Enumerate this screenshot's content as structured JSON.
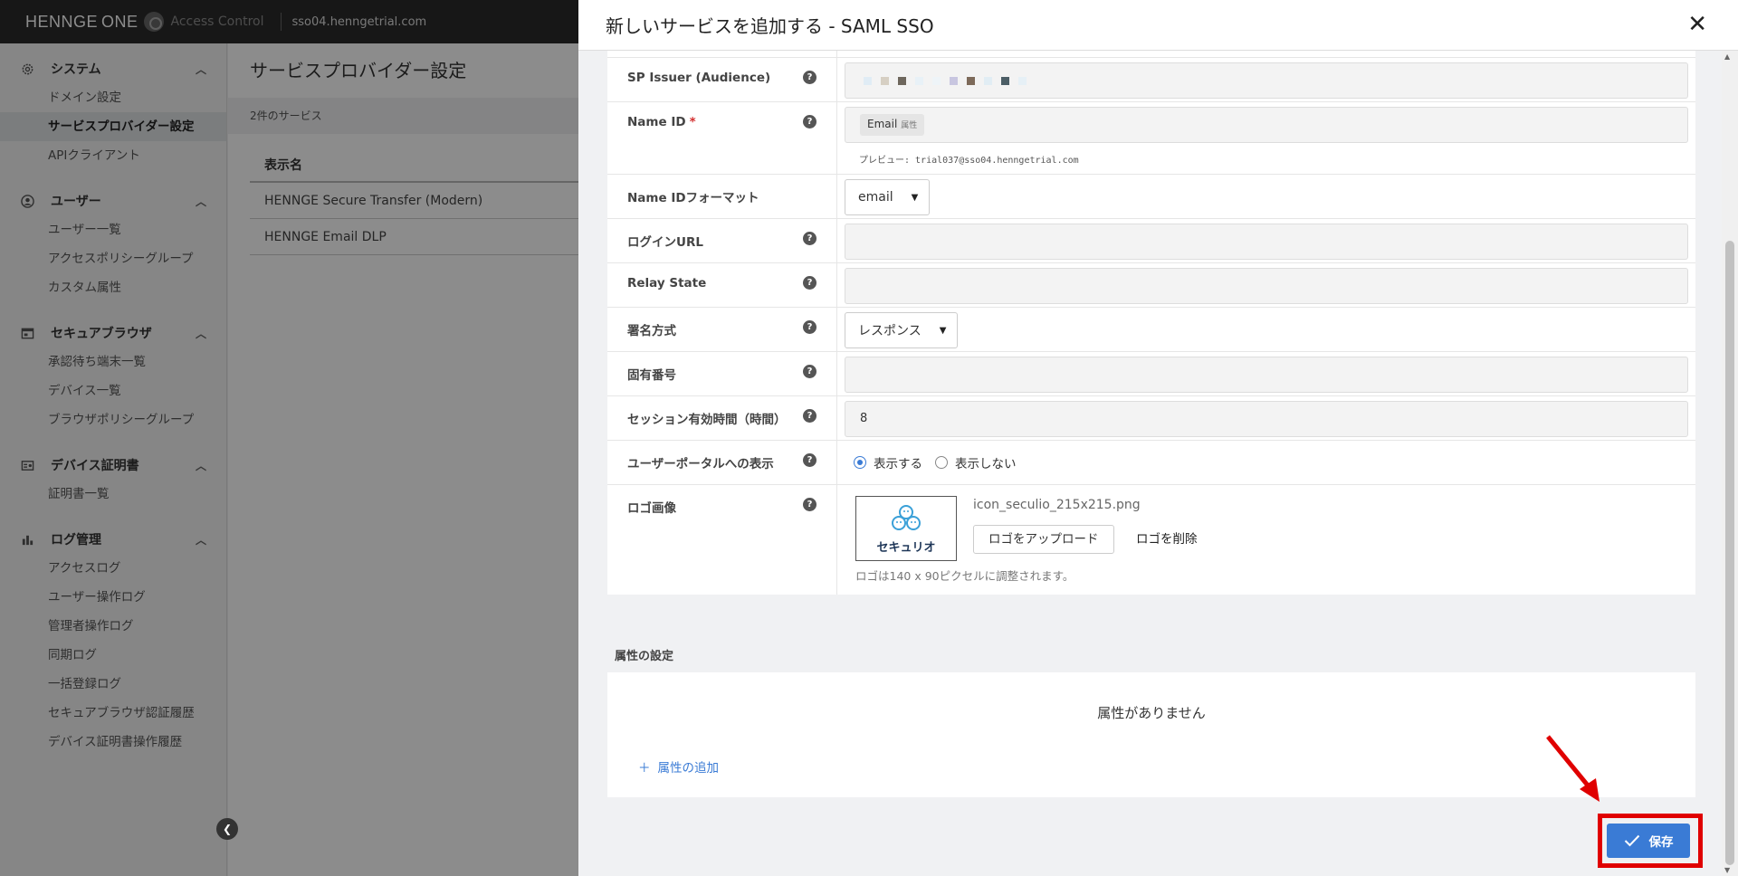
{
  "topbar": {
    "brand": "HENNGE",
    "brand_one": "ONE",
    "brand_sub": "Access Control",
    "domain": "sso04.henngetrial.com"
  },
  "sidebar": {
    "sections": [
      {
        "title": "システム",
        "icon": "gear-icon",
        "items": [
          "ドメイン設定",
          "サービスプロバイダー設定",
          "APIクライアント"
        ]
      },
      {
        "title": "ユーザー",
        "icon": "user-icon",
        "items": [
          "ユーザー一覧",
          "アクセスポリシーグループ",
          "カスタム属性"
        ]
      },
      {
        "title": "セキュアブラウザ",
        "icon": "browser-icon",
        "items": [
          "承認待ち端末一覧",
          "デバイス一覧",
          "ブラウザポリシーグループ"
        ]
      },
      {
        "title": "デバイス証明書",
        "icon": "certificate-icon",
        "items": [
          "証明書一覧"
        ]
      },
      {
        "title": "ログ管理",
        "icon": "chart-icon",
        "items": [
          "アクセスログ",
          "ユーザー操作ログ",
          "管理者操作ログ",
          "同期ログ",
          "一括登録ログ",
          "セキュアブラウザ認証履歴",
          "デバイス証明書操作履歴"
        ]
      }
    ],
    "active_item": "サービスプロバイダー設定"
  },
  "main": {
    "title": "サービスプロバイダー設定",
    "count": "2件のサービス",
    "table_header": "表示名",
    "rows": [
      "HENNGE Secure Transfer (Modern)",
      "HENNGE Email DLP"
    ]
  },
  "modal": {
    "title": "新しいサービスを追加する - SAML SSO",
    "close": "✕",
    "fields": {
      "sp_issuer": {
        "label": "SP Issuer (Audience)"
      },
      "name_id": {
        "label": "Name ID",
        "required": "*",
        "chip": "Email",
        "chip_tag": "属性",
        "preview": "プレビュー: trial037@sso04.henngetrial.com"
      },
      "name_id_format": {
        "label": "Name IDフォーマット",
        "value": "email"
      },
      "login_url": {
        "label": "ログインURL",
        "value": ""
      },
      "relay_state": {
        "label": "Relay State",
        "value": ""
      },
      "signing": {
        "label": "署名方式",
        "value": "レスポンス"
      },
      "unique_id": {
        "label": "固有番号",
        "value": ""
      },
      "session": {
        "label": "セッション有効時間（時間）",
        "value": "8"
      },
      "portal": {
        "label": "ユーザーポータルへの表示",
        "option_show": "表示する",
        "option_hide": "表示しない",
        "selected": "表示する"
      },
      "logo": {
        "label": "ロゴ画像",
        "logo_text": "セキュリオ",
        "filename": "icon_seculio_215x215.png",
        "upload": "ロゴをアップロード",
        "delete": "ロゴを削除",
        "note": "ロゴは140 x 90ピクセルに調整されます。"
      }
    },
    "attributes": {
      "title": "属性の設定",
      "empty": "属性がありません",
      "add": "属性の追加"
    },
    "save": "保存",
    "help_glyph": "?"
  },
  "colors": {
    "accent": "#3a7bd5",
    "highlight": "#e00000",
    "topbar": "#2b2b2b"
  }
}
